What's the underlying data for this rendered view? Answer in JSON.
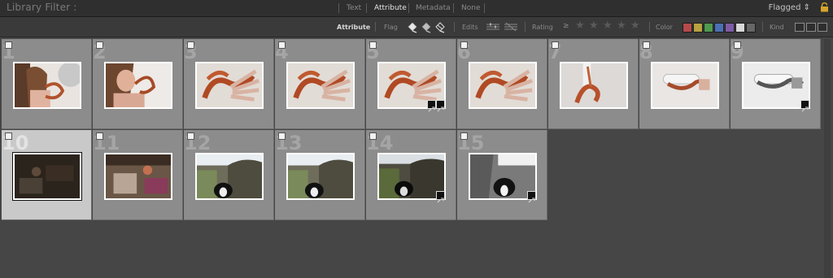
{
  "filter_bar": {
    "title": "Library Filter :",
    "tabs": [
      "Text",
      "Attribute",
      "Metadata",
      "None"
    ],
    "active_tab": "Attribute",
    "preset": "Flagged ⇕"
  },
  "attribute_bar": {
    "label": "Attribute",
    "flag_label": "Flag",
    "edits_label": "Edits",
    "rating_label": "Rating",
    "rating_op": "≥",
    "stars": [
      "★",
      "★",
      "★",
      "★",
      "★"
    ],
    "color_label": "Color",
    "kind_label": "Kind",
    "color_swatches": [
      "#b64a4a",
      "#b7a23f",
      "#4e9a4e",
      "#4b6fb5",
      "#7f5aa6",
      "#d8d8d8",
      "#666666"
    ]
  },
  "grid": {
    "cells": [
      {
        "number": "1",
        "subject": "girl-snake-1",
        "badge": ""
      },
      {
        "number": "2",
        "subject": "girl-snake-2",
        "badge": ""
      },
      {
        "number": "3",
        "subject": "snake-hand",
        "badge": ""
      },
      {
        "number": "4",
        "subject": "snake-hand",
        "badge": ""
      },
      {
        "number": "5",
        "subject": "snake-hand",
        "badge": "edited"
      },
      {
        "number": "6",
        "subject": "snake-hand",
        "badge": ""
      },
      {
        "number": "7",
        "subject": "snake-branch",
        "badge": ""
      },
      {
        "number": "8",
        "subject": "snake-bottle",
        "badge": ""
      },
      {
        "number": "9",
        "subject": "snake-bw",
        "badge": "edited"
      },
      {
        "number": "10",
        "subject": "dark-still",
        "badge": "",
        "selected": true
      },
      {
        "number": "11",
        "subject": "still",
        "badge": ""
      },
      {
        "number": "12",
        "subject": "dog",
        "badge": ""
      },
      {
        "number": "13",
        "subject": "dog",
        "badge": ""
      },
      {
        "number": "14",
        "subject": "dog-dark",
        "badge": "edited"
      },
      {
        "number": "15",
        "subject": "dog-bw",
        "badge": "edited"
      }
    ]
  }
}
